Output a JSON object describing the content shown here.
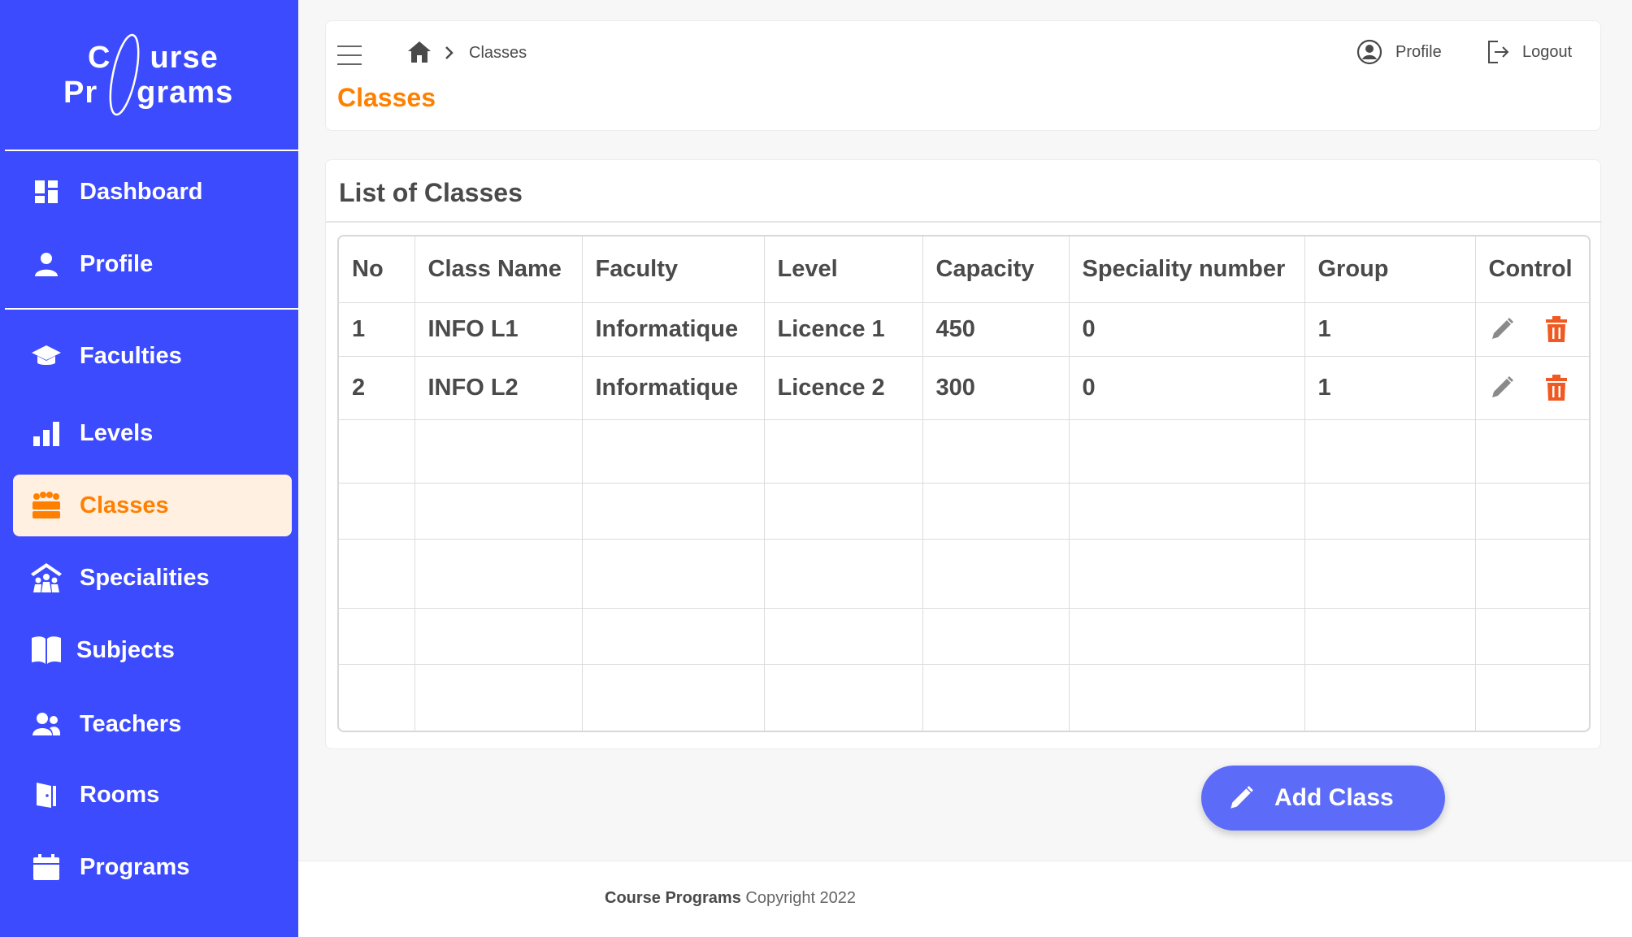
{
  "app": {
    "logo_line1": "C",
    "logo_line1_rest": "urse",
    "logo_line2": "Pr",
    "logo_line2_rest": "grams"
  },
  "sidebar": {
    "items": [
      {
        "label": "Dashboard",
        "icon": "dashboard-icon"
      },
      {
        "label": "Profile",
        "icon": "user-icon"
      },
      {
        "label": "Faculties",
        "icon": "graduation-cap-icon"
      },
      {
        "label": "Levels",
        "icon": "bar-chart-icon"
      },
      {
        "label": "Classes",
        "icon": "class-seats-icon",
        "active": true
      },
      {
        "label": "Specialities",
        "icon": "people-roof-icon"
      },
      {
        "label": "Subjects",
        "icon": "book-icon"
      },
      {
        "label": "Teachers",
        "icon": "users-icon"
      },
      {
        "label": "Rooms",
        "icon": "door-icon"
      },
      {
        "label": "Programs",
        "icon": "calendar-icon"
      }
    ]
  },
  "header": {
    "breadcrumb_current": "Classes",
    "page_title": "Classes",
    "profile_label": "Profile",
    "logout_label": "Logout"
  },
  "table": {
    "title": "List of Classes",
    "columns": [
      "No",
      "Class Name",
      "Faculty",
      "Level",
      "Capacity",
      "Speciality number",
      "Group",
      "Control"
    ],
    "rows": [
      [
        "1",
        "INFO L1",
        "Informatique",
        "Licence 1",
        "450",
        "0",
        "1"
      ],
      [
        "2",
        "INFO L2",
        "Informatique",
        "Licence 2",
        "300",
        "0",
        "1"
      ]
    ]
  },
  "add_button": {
    "label": "Add Class"
  },
  "footer": {
    "brand": "Course Programs",
    "text": "Copyright 2022"
  },
  "colors": {
    "sidebar": "#3d4bff",
    "accent": "#ff8000",
    "delete": "#f05a22",
    "button": "#5c6cf8"
  }
}
